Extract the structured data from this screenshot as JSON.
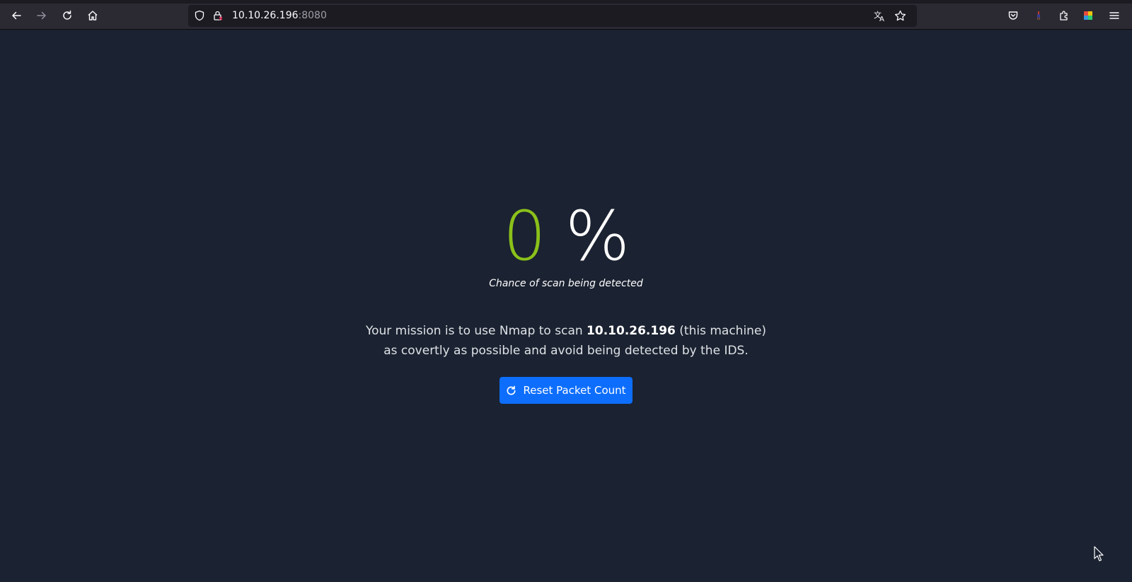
{
  "browser": {
    "url_host": "10.10.26.196",
    "url_port": ":8080"
  },
  "page": {
    "percentage_value": "0",
    "percentage_sign": "%",
    "caption": "Chance of scan being detected",
    "mission_prefix": "Your mission is to use Nmap to scan",
    "mission_target": "10.10.26.196",
    "mission_suffix": "(this machine)",
    "mission_line2": "as covertly as possible and avoid being detected by the IDS.",
    "reset_button_label": "Reset Packet Count"
  },
  "colors": {
    "background": "#1b2231",
    "percentage_value": "#8bc11a",
    "button": "#0d6efd"
  }
}
